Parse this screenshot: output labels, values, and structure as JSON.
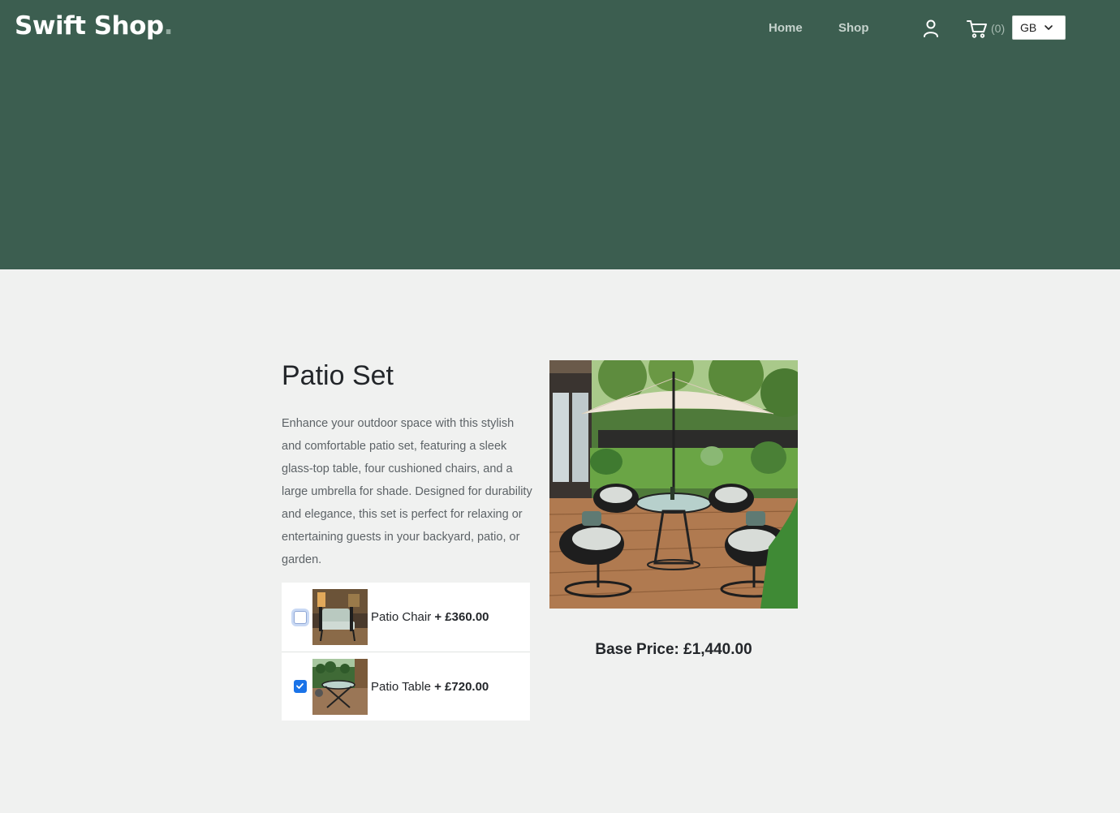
{
  "header": {
    "logo_text": "Swift Shop",
    "logo_dot": ".",
    "nav": [
      {
        "label": "Home"
      },
      {
        "label": "Shop"
      }
    ],
    "cart_count": "(0)",
    "country": "GB",
    "colors": {
      "hero_bg": "#3c5e50",
      "accent": "#1a73e8"
    }
  },
  "product": {
    "title": "Patio Set",
    "description": "Enhance your outdoor space with this stylish and comfortable patio set, featuring a sleek glass-top table, four cushioned chairs, and a large umbrella for shade. Designed for durability and elegance, this set is perfect for relaxing or entertaining guests in your backyard, patio, or garden.",
    "options": [
      {
        "name": "Patio Chair",
        "price": "+ £360.00",
        "checked": false
      },
      {
        "name": "Patio Table",
        "price": "+ £720.00",
        "checked": true
      }
    ],
    "base_price": "Base Price: £1,440.00"
  },
  "icons": [
    "user-icon",
    "cart-icon",
    "chevron-down-icon",
    "checkmark-icon"
  ]
}
